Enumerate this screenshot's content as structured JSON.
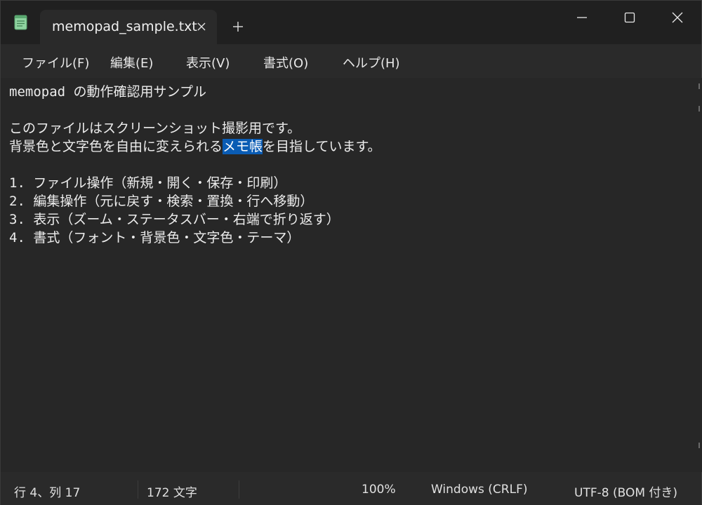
{
  "tab": {
    "title": "memopad_sample.txt"
  },
  "menu": [
    {
      "label": "ファイル(F)"
    },
    {
      "label": "編集(E)"
    },
    {
      "label": "表示(V)"
    },
    {
      "label": "書式(O)"
    },
    {
      "label": "ヘルプ(H)"
    }
  ],
  "editor": {
    "line1": "memopad の動作確認用サンプル",
    "line2": "",
    "line3": "このファイルはスクリーンショット撮影用です。",
    "line4_before": "背景色と文字色を自由に変えられる",
    "line4_selected": "メモ帳",
    "line4_after": "を目指しています。",
    "line5": "",
    "list": [
      {
        "num": "1.",
        "text": "ファイル操作（新規・開く・保存・印刷）"
      },
      {
        "num": "2.",
        "text": "編集操作（元に戻す・検索・置換・行へ移動）"
      },
      {
        "num": "3.",
        "text": "表示（ズーム・ステータスバー・右端で折り返す）"
      },
      {
        "num": "4.",
        "text": "書式（フォント・背景色・文字色・テーマ）"
      }
    ]
  },
  "status": {
    "position": "行 4、列 17",
    "char_count": "172 文字",
    "zoom": "100%",
    "line_ending": "Windows (CRLF)",
    "encoding": "UTF-8 (BOM 付き)"
  },
  "icons": {
    "app": "notepad-icon",
    "tab_close": "close-icon",
    "new_tab": "plus-icon",
    "minimize": "minimize-icon",
    "maximize": "maximize-icon",
    "close": "close-icon"
  },
  "colors": {
    "background": "#272727",
    "titlebar": "#202020",
    "selection": "#0a5cb4",
    "text": "#ececec"
  }
}
